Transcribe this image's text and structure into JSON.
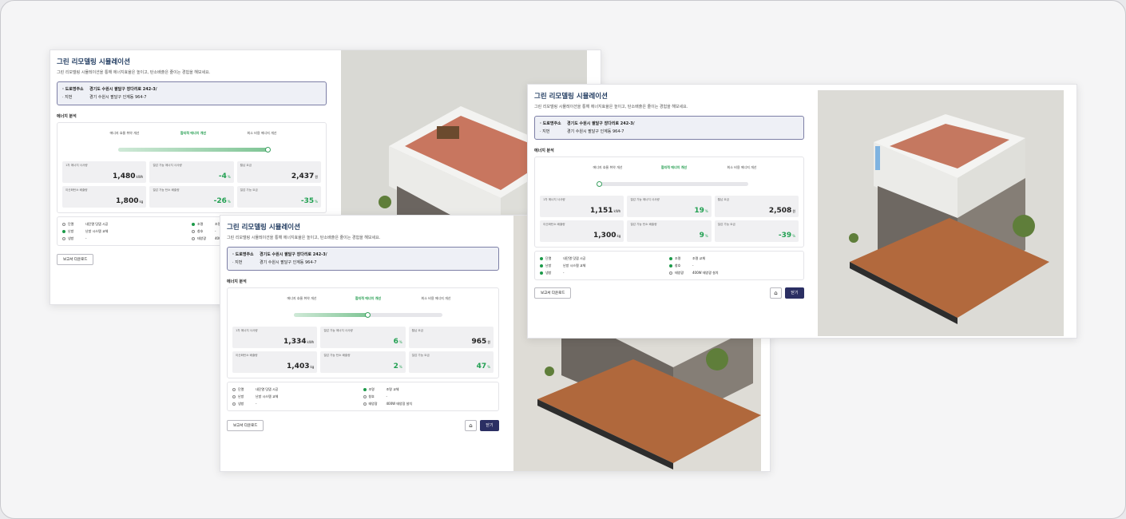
{
  "common": {
    "title": "그린 리모델링 시뮬레이션",
    "subtitle": "그린 리모델링 시뮬레이션을 통해 에너지효율은 높이고, 탄소배출은 줄이는 경험을 해보세요.",
    "road_label": "· 도로명주소",
    "road_value": "경기도 수원시 팔달구 장다리로 242-3/",
    "lot_label": "· 지번",
    "lot_value": "경기 수원시 팔달구 인계동 964-7",
    "energy_label": "에너지 분석",
    "step1": "에너지 효율 취약 개선",
    "step2": "합리적 에너지 개선",
    "step3": "최소 비용 에너지 개선",
    "lab_usage": "1차 에너지 사사량",
    "lab_saving": "절감 가능 에너지 사사량",
    "lab_cost": "월납 요금",
    "lab_co2": "이산화탄소 배출량",
    "lab_co2_saving": "절감 가능 탄소 배출량",
    "lab_fee_saving": "절감 가능 요금",
    "opt_insul": "단열",
    "opt_insul_val": "내단열 덧댐 시공",
    "opt_heat": "난방",
    "opt_heat_val": "난방 시스템 교체",
    "opt_cool": "냉방",
    "opt_cool_val": "-",
    "opt_light": "조명",
    "opt_light_val": "조명 교체",
    "opt_window": "창호",
    "opt_window_val": "-",
    "opt_solar": "태양광",
    "opt_solar_val": "400W 태양광 설치",
    "download": "보고서 다운로드",
    "home_icon": "⌂",
    "close": "닫기"
  },
  "cards": [
    {
      "usage": "1,480",
      "usage_unit": "kWh",
      "saving": "-4",
      "cost": "2,437",
      "co2": "1,800",
      "co2_unit": "kg",
      "co2_saving": "-26",
      "fee_saving": "-35",
      "progress": 1.0
    },
    {
      "usage": "1,334",
      "usage_unit": "kWh",
      "saving": "6",
      "cost": "965",
      "co2": "1,403",
      "co2_unit": "kg",
      "co2_saving": "2",
      "fee_saving": "47",
      "progress": 0.5
    },
    {
      "usage": "1,151",
      "usage_unit": "kWh",
      "saving": "19",
      "cost": "2,508",
      "co2": "1,300",
      "co2_unit": "kg",
      "co2_saving": "9",
      "fee_saving": "-39",
      "progress": 0.0
    }
  ],
  "units": {
    "percent": "%",
    "won": "원"
  }
}
